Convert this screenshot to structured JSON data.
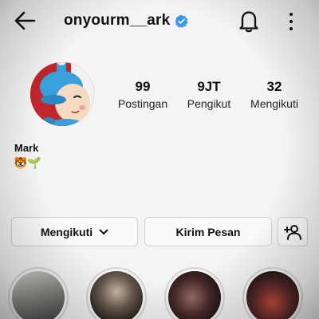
{
  "header": {
    "username": "onyourm__ark",
    "back_icon": "arrow-left-icon",
    "verified_icon": "verified-badge-icon",
    "bell_icon": "bell-icon",
    "more_icon": "more-vertical-icon"
  },
  "profile": {
    "name": "Mark",
    "bio": "🐯🌱"
  },
  "stats": {
    "posts": {
      "value": "99",
      "label": "Postingan"
    },
    "followers": {
      "value": "9JT",
      "label": "Pengikut"
    },
    "following": {
      "value": "32",
      "label": "Mengikuti"
    }
  },
  "actions": {
    "follow_label": "Mengikuti",
    "message_label": "Kirim Pesan",
    "add_user_icon": "add-user-icon",
    "chevron_icon": "chevron-down-icon"
  },
  "colors": {
    "verified": "#3897f0",
    "background": "#f4f4f4"
  }
}
